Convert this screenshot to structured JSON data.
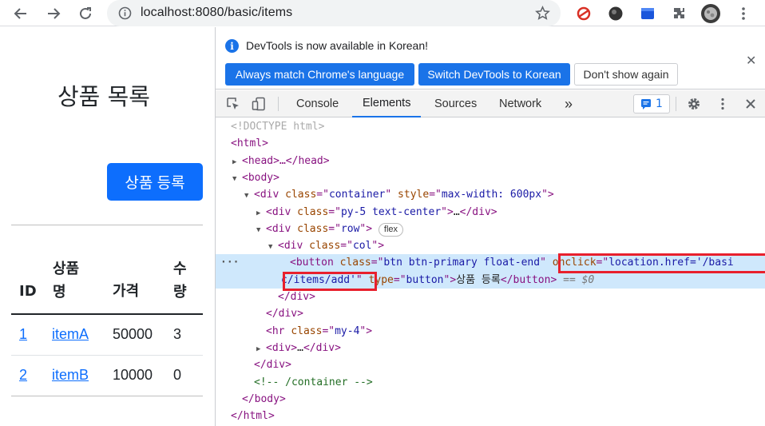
{
  "browser": {
    "url": "localhost:8080/basic/items"
  },
  "page": {
    "title": "상품 목록",
    "add_button": "상품 등록",
    "table": {
      "headers": [
        "ID",
        "상품\n명",
        "가격",
        "수\n량"
      ],
      "rows": [
        {
          "id": "1",
          "name": "itemA",
          "price": "50000",
          "qty": "3"
        },
        {
          "id": "2",
          "name": "itemB",
          "price": "10000",
          "qty": "0"
        }
      ]
    }
  },
  "devtools": {
    "banner_message": "DevTools is now available in Korean!",
    "banner_buttons": [
      "Always match Chrome's language",
      "Switch DevTools to Korean",
      "Don't show again"
    ],
    "tabs": [
      "Console",
      "Elements",
      "Sources",
      "Network"
    ],
    "active_tab": "Elements",
    "more_tabs": "»",
    "message_count": "1",
    "dom": {
      "doctype": "<!DOCTYPE html>",
      "html_open": "<html>",
      "head": "<head>…</head>",
      "body_open": "<body>",
      "container_class": "container",
      "container_style": "max-width: 600px",
      "py5_class": "py-5 text-center",
      "row_class": "row",
      "flex_badge": "flex",
      "col_class": "col",
      "button_class": "btn btn-primary float-end",
      "onclick_value_1": "location.href='/basi",
      "onclick_value_2": "c/items/add'",
      "button_type": "button",
      "button_text": "상품 등록",
      "eq_marker": "== $0",
      "hr_class": "my-4",
      "comment": "<!-- /container -->",
      "ellipsis": "…"
    }
  },
  "colors": {
    "primary": "#0d6efd",
    "devtools_accent": "#1a73e8",
    "highlight_red": "#e8202d",
    "selected_row": "#cfe8fc"
  }
}
